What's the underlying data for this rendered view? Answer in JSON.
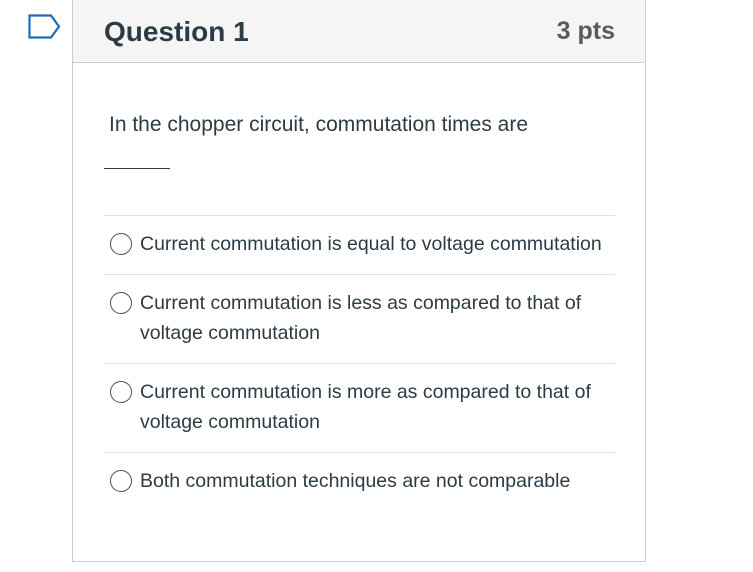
{
  "question": {
    "title": "Question 1",
    "points": "3 pts",
    "text": "In the chopper circuit, commutation times are",
    "blank": "______"
  },
  "answers": [
    {
      "label": "Current commutation is equal to voltage commutation"
    },
    {
      "label": "Current commutation is less as compared to that of voltage commutation"
    },
    {
      "label": "Current commutation is more as compared to that of voltage commutation"
    },
    {
      "label": "Both commutation techniques are not comparable"
    }
  ],
  "colors": {
    "flag_icon": "#1e6bb8",
    "header_bg": "#f5f5f5",
    "text": "#2d3b45",
    "border": "#c7cdd1"
  },
  "icons": {
    "flag": "bookmark-flag-icon",
    "radio": "radio-button-icon"
  }
}
